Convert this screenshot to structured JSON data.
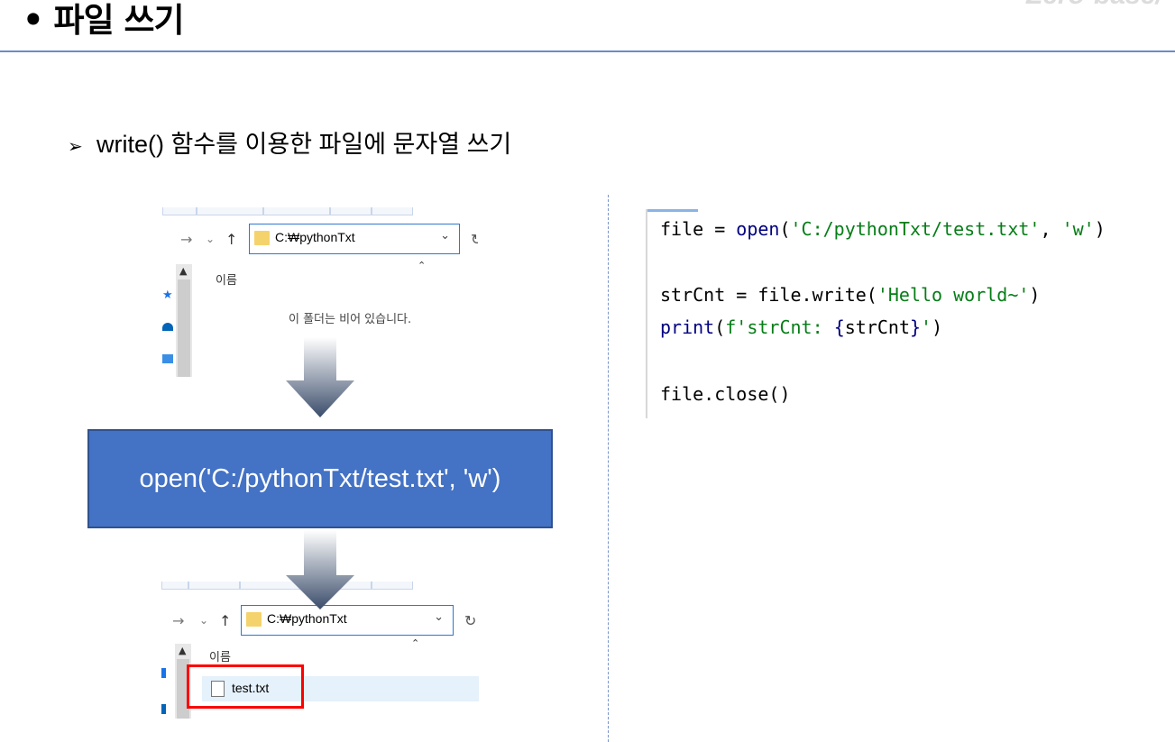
{
  "header": {
    "title": "• 파일 쓰기",
    "brand": "Zero-base/"
  },
  "bullet": {
    "marker": "➢",
    "text": "write() 함수를 이용한 파일에 문자열 쓰기"
  },
  "explorer_top": {
    "address": "C:₩pythonTxt",
    "column_header": "이름",
    "empty_message": "이 폴더는 비어 있습니다."
  },
  "step_box": {
    "text": "open('C:/pythonTxt/test.txt', 'w')"
  },
  "explorer_bottom": {
    "address": "C:₩pythonTxt",
    "column_header": "이름",
    "file_name": "test.txt"
  },
  "code": {
    "line1": {
      "a": "file = ",
      "b": "open",
      "c": "(",
      "d": "'C:/pythonTxt/test.txt'",
      "e": ", ",
      "f": "'w'",
      "g": ")"
    },
    "line2": {
      "a": "strCnt = file.write(",
      "b": "'Hello world~'",
      "c": ")"
    },
    "line3": {
      "a": "print",
      "b": "(",
      "c": "f'strCnt: ",
      "d": "{",
      "e": "strCnt",
      "f": "}",
      "g": "'",
      "h": ")"
    },
    "line4": {
      "a": "file.close()"
    }
  },
  "colors": {
    "accent_blue": "#4472c4",
    "rule": "#6d8bc7",
    "highlight": "#ff0000",
    "code_string": "#067d17",
    "code_keyword": "#000080"
  }
}
